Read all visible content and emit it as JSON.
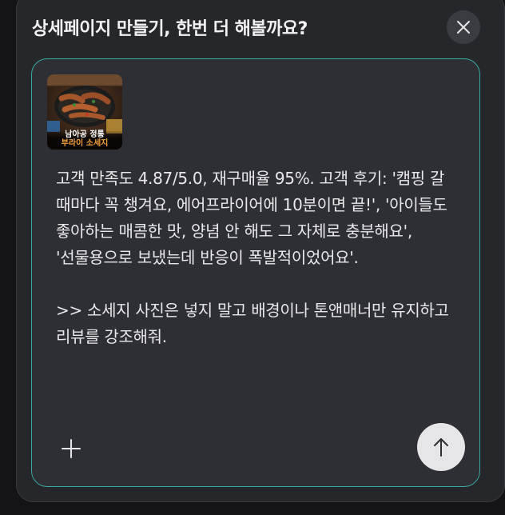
{
  "dialog": {
    "title": "상세페이지 만들기, 한번 더 해볼까요?",
    "close_icon": "close-icon"
  },
  "composer": {
    "attachment": {
      "caption_line1": "남아공 정통",
      "caption_line2": "부라이 소세지",
      "icon": "image-thumbnail"
    },
    "message_text": "고객 만족도 4.87/5.0, 재구매율 95%. 고객 후기: '캠핑 갈 때마다 꼭 챙겨요, 에어프라이어에 10분이면 끝!', '아이들도 좋아하는 매콤한 맛, 양념 안 해도 그 자체로 충분해요', '선물용으로 보냈는데 반응이 폭발적이었어요'.\n\n>> 소세지 사진은 넣지 말고 배경이나 톤앤매너만 유지하고 리뷰를 강조해줘.",
    "add_icon": "plus-icon",
    "send_icon": "arrow-up-icon",
    "accent_color": "#3aa7a3"
  }
}
